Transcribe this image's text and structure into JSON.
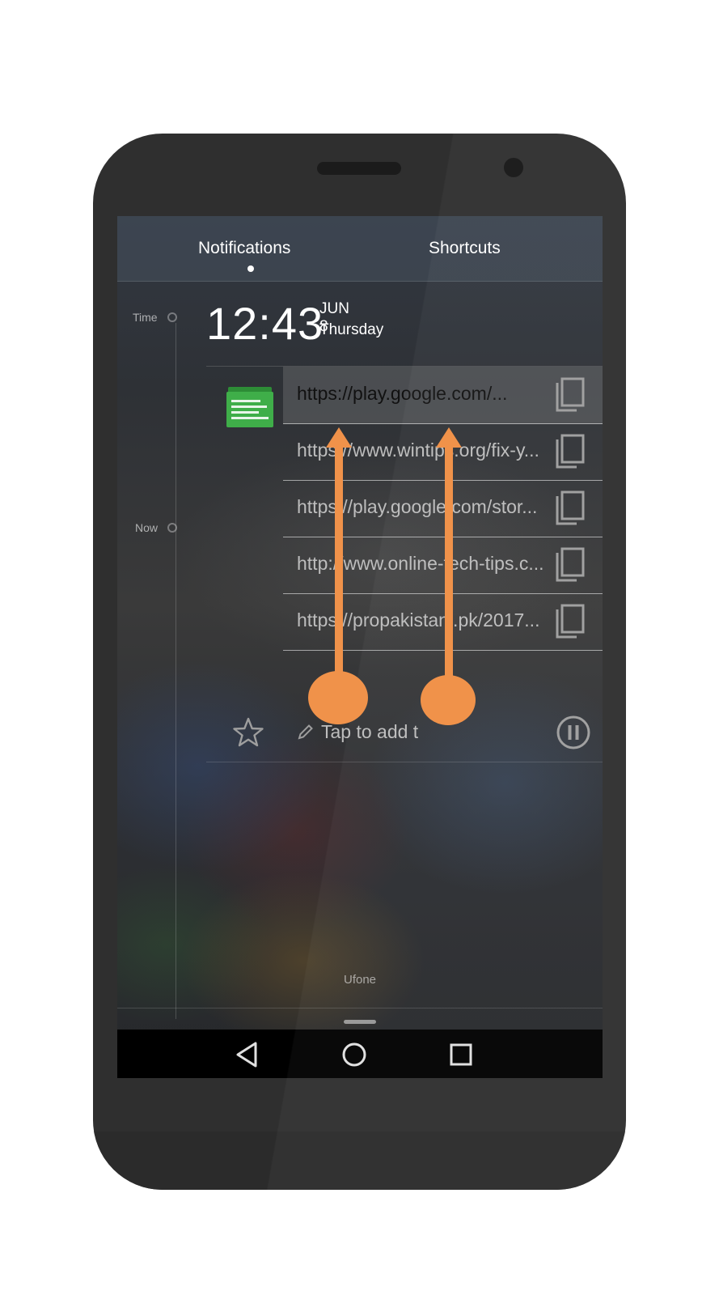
{
  "tabs": {
    "notifications": "Notifications",
    "shortcuts": "Shortcuts",
    "active": "notifications"
  },
  "timeline": {
    "time_label": "Time",
    "now_label": "Now"
  },
  "clock": {
    "time": "12:43",
    "date": "JUN 8",
    "weekday": "Thursday"
  },
  "clipboard": {
    "app_icon": "clipboard-app-icon",
    "items": [
      {
        "text": "https://play.google.com/..."
      },
      {
        "text": "https://www.wintips.org/fix-y..."
      },
      {
        "text": "https://play.google.com/stor..."
      },
      {
        "text": "http://www.online-tech-tips.c..."
      },
      {
        "text": "https://propakistani.pk/2017..."
      }
    ],
    "add_placeholder": "Tap to add t",
    "copy_icon": "copy-icon",
    "star_icon": "star-icon",
    "pause_icon": "pause-icon"
  },
  "carrier": "Ufone",
  "navbar": {
    "back_icon": "back-icon",
    "home_icon": "home-icon",
    "recents_icon": "recents-icon"
  },
  "colors": {
    "accent_arrow": "#F0924A",
    "clip_icon_green": "#3FAE49",
    "navbar": "#000000"
  }
}
